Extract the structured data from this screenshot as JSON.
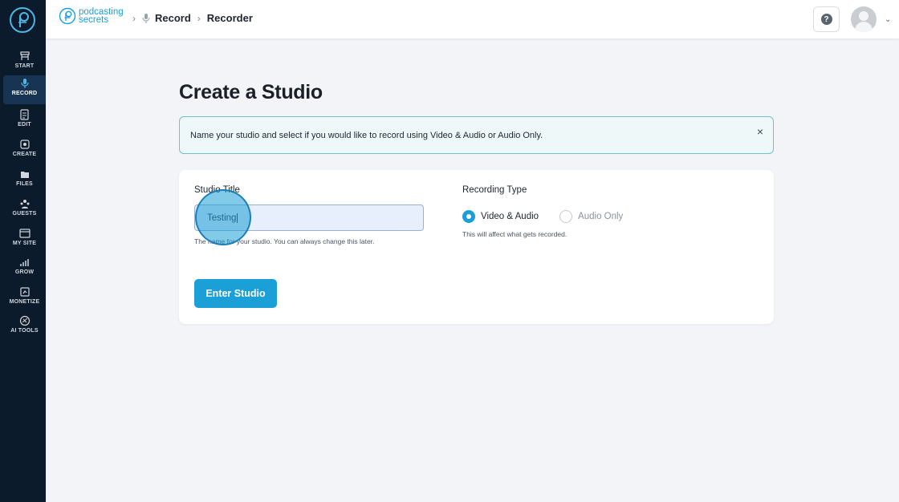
{
  "brand": {
    "line1": "podcasting",
    "line2": "secrets"
  },
  "sidebar": {
    "items": [
      {
        "label": "START",
        "icon": "start-icon"
      },
      {
        "label": "RECORD",
        "icon": "microphone-icon",
        "active": true
      },
      {
        "label": "EDIT",
        "icon": "edit-icon"
      },
      {
        "label": "CREATE",
        "icon": "create-icon"
      },
      {
        "label": "FILES",
        "icon": "files-icon"
      },
      {
        "label": "GUESTS",
        "icon": "guests-icon"
      },
      {
        "label": "MY SITE",
        "icon": "site-icon"
      },
      {
        "label": "GROW",
        "icon": "grow-icon"
      },
      {
        "label": "MONETIZE",
        "icon": "monetize-icon"
      },
      {
        "label": "AI TOOLS",
        "icon": "ai-tools-icon"
      }
    ]
  },
  "breadcrumb": {
    "first": "Record",
    "second": "Recorder"
  },
  "header": {
    "help": "?"
  },
  "page": {
    "title": "Create a Studio",
    "alert": "Name your studio and select if you would like to record using Video & Audio or Audio Only.",
    "alert_close": "×"
  },
  "form": {
    "studio_title_label": "Studio Title",
    "studio_title_value": "Testing",
    "studio_title_hint": "The name for your studio. You can always change this later.",
    "recording_type_label": "Recording Type",
    "options": [
      {
        "label": "Video & Audio",
        "selected": true
      },
      {
        "label": "Audio Only",
        "selected": false
      }
    ],
    "recording_type_hint": "This will affect what gets recorded.",
    "submit_label": "Enter Studio"
  },
  "colors": {
    "accent": "#1a9fd6",
    "sidebar": "#0c1b2b",
    "sidebar_active": "#173553"
  }
}
